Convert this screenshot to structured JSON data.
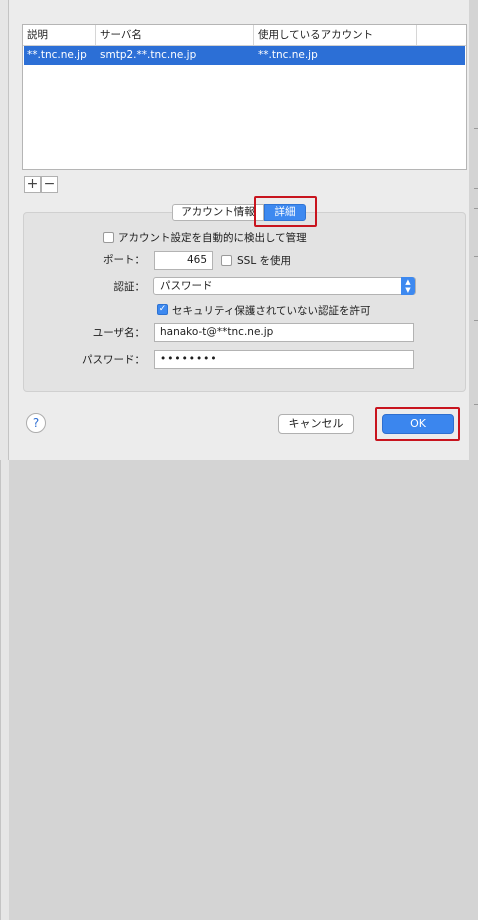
{
  "accounts_table": {
    "columns": [
      "説明",
      "サーバ名",
      "使用しているアカウント"
    ],
    "rows": [
      {
        "description": "**.tnc.ne.jp",
        "server": "smtp2.**.tnc.ne.jp",
        "account": "**.tnc.ne.jp"
      }
    ]
  },
  "table_buttons": {
    "add": "+",
    "remove": "−"
  },
  "tabs": {
    "account_info": "アカウント情報",
    "details": "詳細",
    "selected": "details"
  },
  "details": {
    "auto_detect_label": "アカウント設定を自動的に検出して管理",
    "auto_detect_checked": false,
    "port_label": "ポート：",
    "port_value": "465",
    "ssl_label": "SSL を使用",
    "ssl_checked": false,
    "auth_label": "認証：",
    "auth_value": "パスワード",
    "allow_insecure_label": "セキュリティ保護されていない認証を許可",
    "allow_insecure_checked": true,
    "username_label": "ユーザ名：",
    "username_value": "hanako-t@**tnc.ne.jp",
    "password_label": "パスワード：",
    "password_value": "••••••••"
  },
  "footer": {
    "help": "?",
    "cancel": "キャンセル",
    "ok": "OK"
  },
  "colors": {
    "accent": "#3d89f0",
    "selection": "#2c6fd6",
    "highlight_box": "#c8141e"
  },
  "icons": {
    "help": "question-mark-icon",
    "select_arrow": "up-down-chevron-icon",
    "check": "checkmark-icon"
  }
}
